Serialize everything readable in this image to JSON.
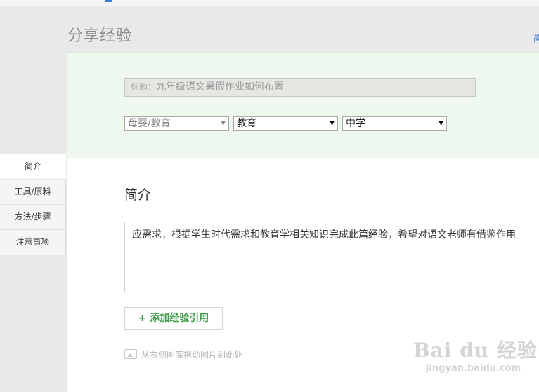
{
  "header": {
    "page_title": "分享经验",
    "right_link": "简"
  },
  "form": {
    "title_label": "标题：",
    "title_value": "九年级语文暑假作业如何布置",
    "category": {
      "primary": "母婴/教育",
      "secondary": "教育",
      "tertiary": "中学"
    }
  },
  "sidenav": {
    "items": [
      "简介",
      "工具/原料",
      "方法/步骤",
      "注意事项"
    ],
    "active": "简介"
  },
  "section": {
    "title": "简介",
    "body": "应需求，根据学生时代需求和教育学相关知识完成此篇经验，希望对语文老师有借鉴作用",
    "add_button": "+ 添加经验引用",
    "drag_hint": "从右侧图库拖动图片到此处"
  },
  "watermark": {
    "brand": "Bai du 经验",
    "url": "jingyan.baidu.com"
  },
  "colors": {
    "accent_green": "#3d9a48",
    "panel_green": "#eef8ef",
    "link_blue": "#3a7bd5"
  }
}
